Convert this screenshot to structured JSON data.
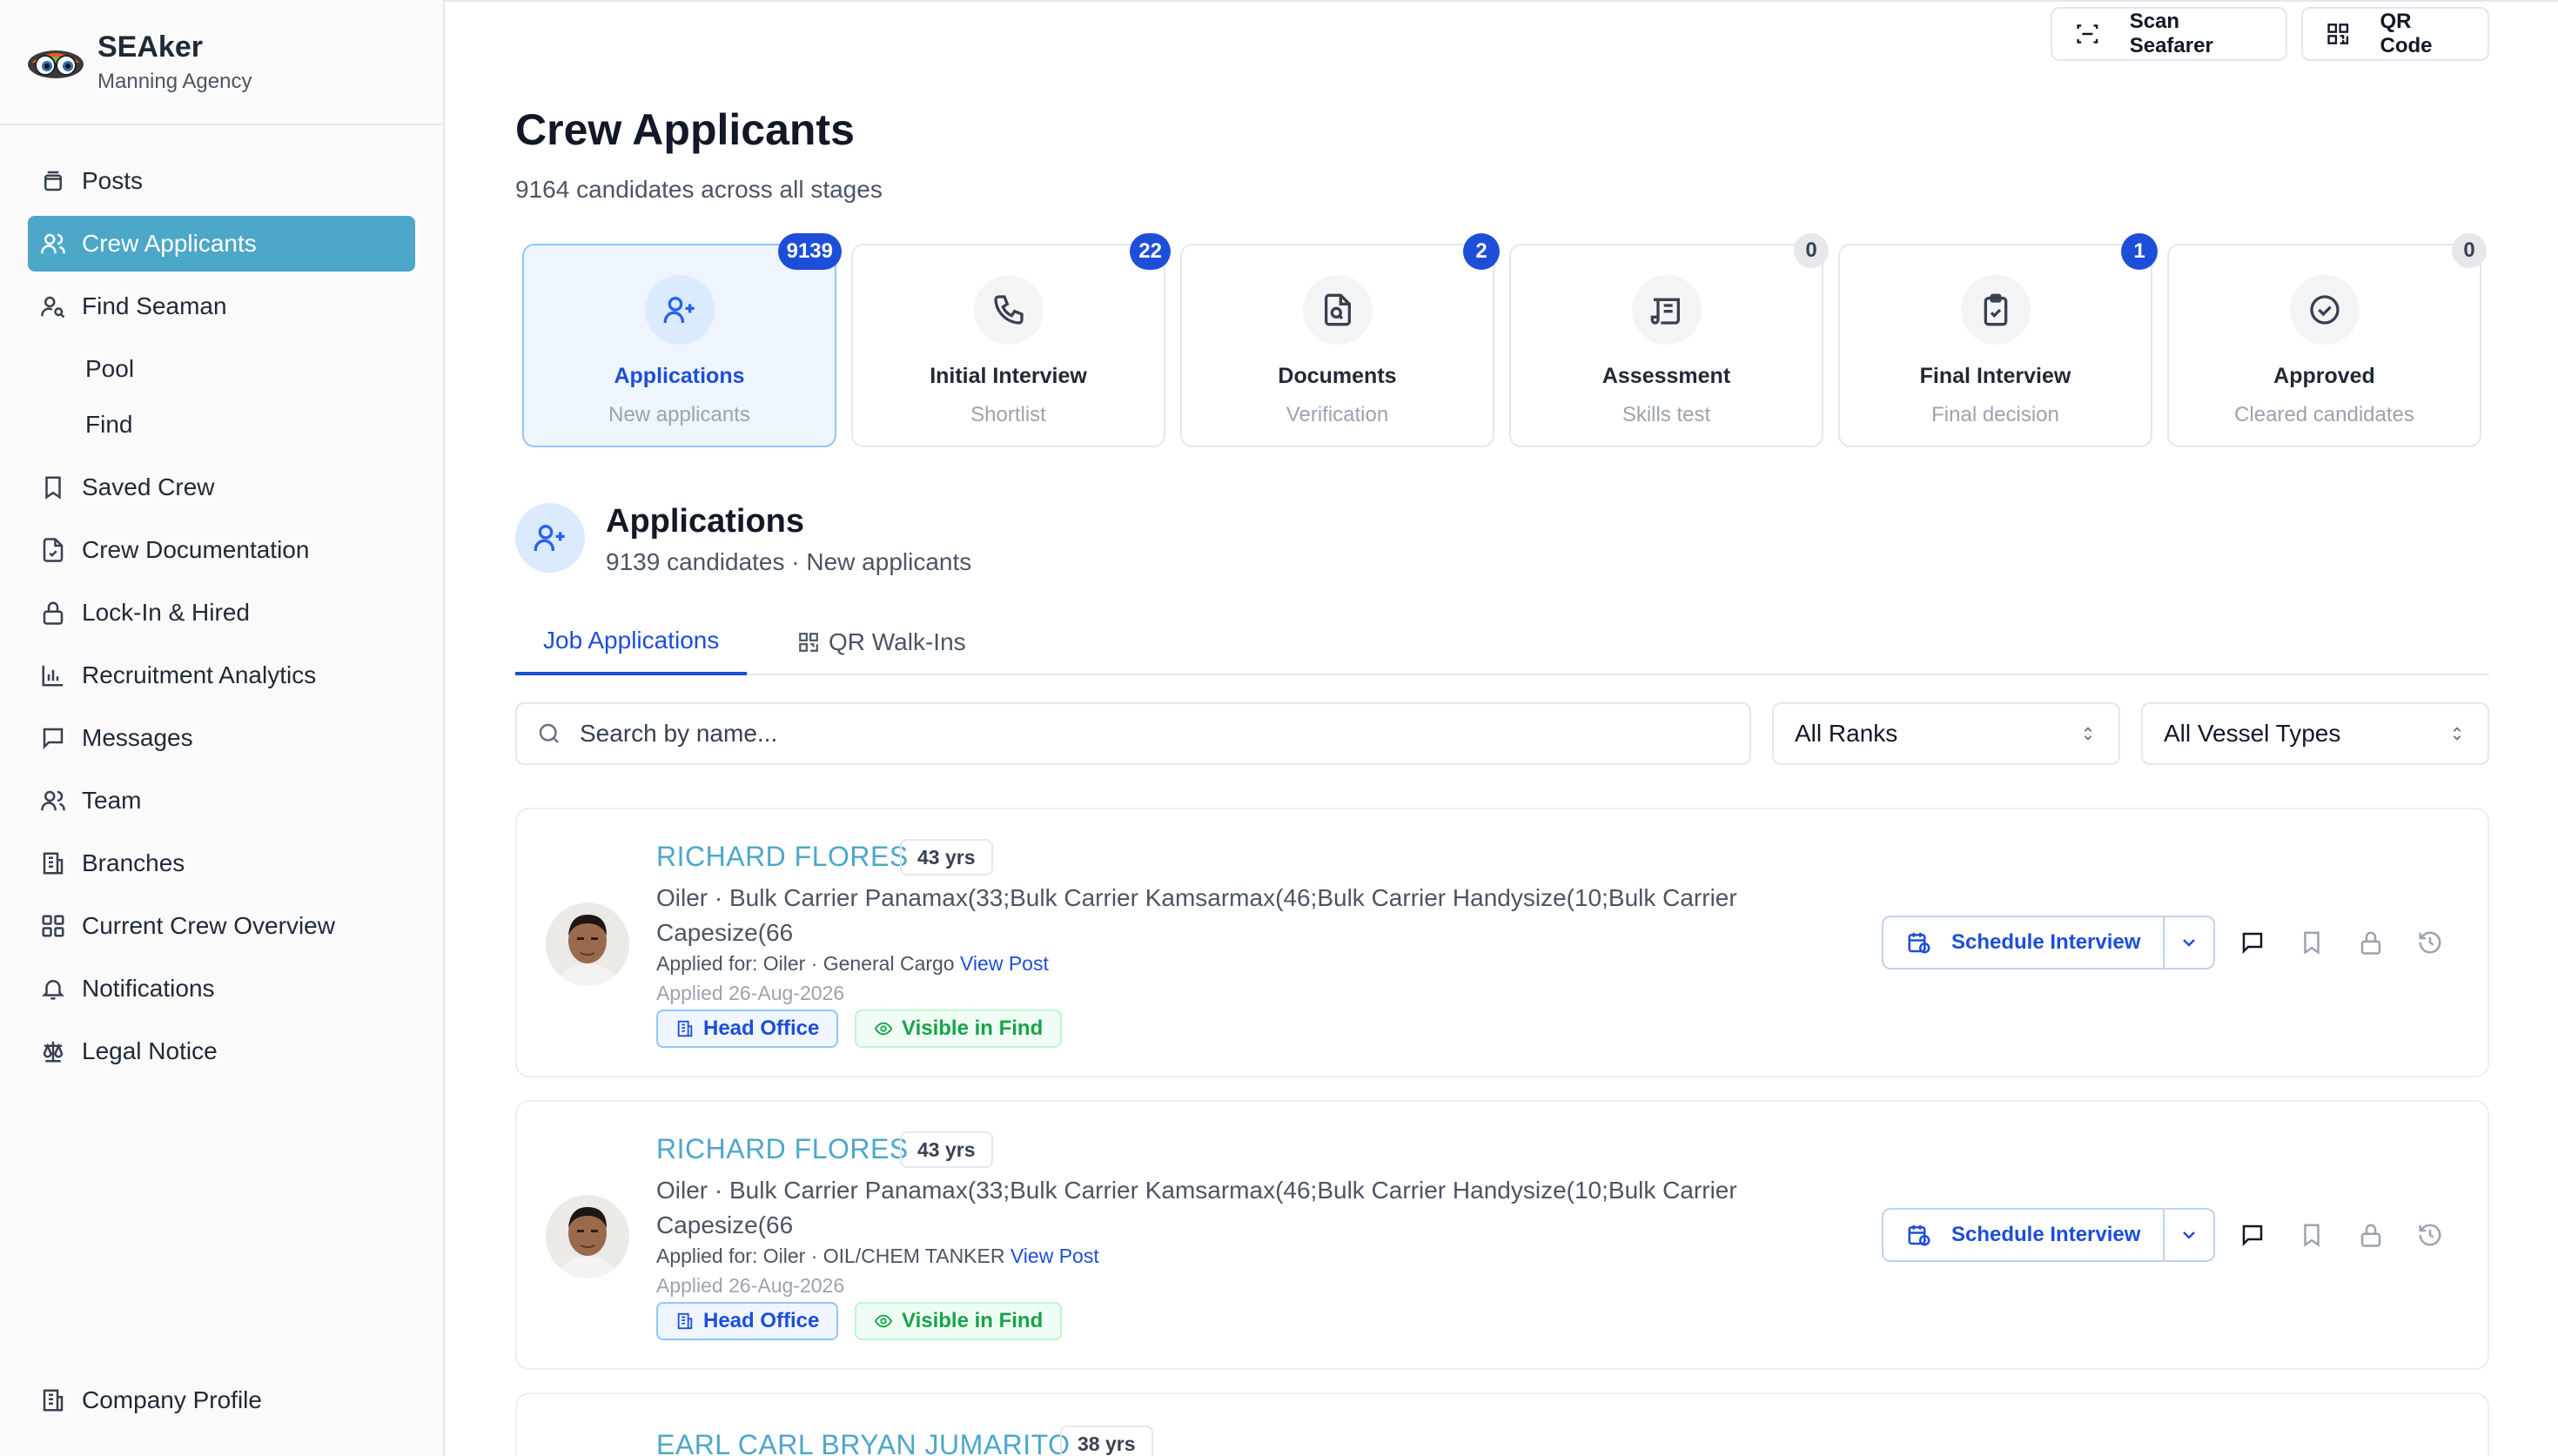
{
  "brand": {
    "name": "SEAker",
    "subtitle": "Manning Agency"
  },
  "nav": {
    "posts": "Posts",
    "crew_applicants": "Crew Applicants",
    "find_seaman": "Find Seaman",
    "pool": "Pool",
    "find": "Find",
    "saved_crew": "Saved Crew",
    "crew_documentation": "Crew Documentation",
    "lock_in_hired": "Lock-In & Hired",
    "recruitment_analytics": "Recruitment Analytics",
    "messages": "Messages",
    "team": "Team",
    "branches": "Branches",
    "current_crew_overview": "Current Crew Overview",
    "notifications": "Notifications",
    "legal_notice": "Legal Notice",
    "company_profile": "Company Profile"
  },
  "top_actions": {
    "scan": "Scan Seafarer",
    "qr": "QR Code"
  },
  "page": {
    "title": "Crew Applicants",
    "subtitle": "9164 candidates across all stages"
  },
  "stages": [
    {
      "title": "Applications",
      "sub": "New applicants",
      "count": "9139"
    },
    {
      "title": "Initial Interview",
      "sub": "Shortlist",
      "count": "22"
    },
    {
      "title": "Documents",
      "sub": "Verification",
      "count": "2"
    },
    {
      "title": "Assessment",
      "sub": "Skills test",
      "count": "0"
    },
    {
      "title": "Final Interview",
      "sub": "Final decision",
      "count": "1"
    },
    {
      "title": "Approved",
      "sub": "Cleared candidates",
      "count": "0"
    }
  ],
  "section": {
    "title": "Applications",
    "subtitle": "9139 candidates · New applicants"
  },
  "tabs": {
    "job": "Job Applications",
    "qr": "QR Walk-Ins"
  },
  "filters": {
    "search_placeholder": "Search by name...",
    "ranks": "All Ranks",
    "vessel_types": "All Vessel Types"
  },
  "candidates": [
    {
      "name": "RICHARD FLORES",
      "age": "43 yrs",
      "desc": "Oiler · Bulk Carrier Panamax(33;Bulk Carrier Kamsarmax(46;Bulk Carrier Handysize(10;Bulk Carrier Capesize(66",
      "applied_for": "Applied for: Oiler · General Cargo",
      "view_post": "View Post",
      "applied_date": "Applied 26-Aug-2026",
      "office": "Head Office",
      "visible": "Visible in Find",
      "schedule": "Schedule Interview"
    },
    {
      "name": "RICHARD FLORES",
      "age": "43 yrs",
      "desc": "Oiler · Bulk Carrier Panamax(33;Bulk Carrier Kamsarmax(46;Bulk Carrier Handysize(10;Bulk Carrier Capesize(66",
      "applied_for": "Applied for: Oiler · OIL/CHEM TANKER",
      "view_post": "View Post",
      "applied_date": "Applied 26-Aug-2026",
      "office": "Head Office",
      "visible": "Visible in Find",
      "schedule": "Schedule Interview"
    },
    {
      "name": "EARL CARL BRYAN JUMARITO",
      "age": "38 yrs"
    }
  ],
  "colors": {
    "accent": "#4ca7c9",
    "primary": "#1d4ed8",
    "success": "#16a34a"
  }
}
